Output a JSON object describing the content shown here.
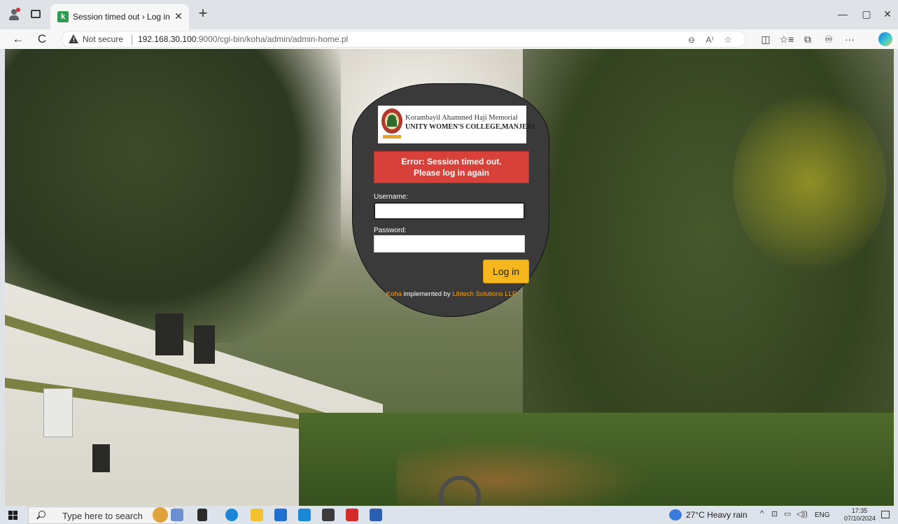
{
  "browser": {
    "tab": {
      "title": "Session timed out › Log in to Koh",
      "favicon_letter": "k",
      "close_glyph": "✕"
    },
    "new_tab_glyph": "+",
    "window_controls": {
      "minimize": "—",
      "restore": "▢",
      "close": "✕"
    },
    "nav": {
      "back_glyph": "←",
      "refresh_glyph": "C"
    },
    "address": {
      "security_label": "Not secure",
      "url_host": "192.168.30.100",
      "url_rest": ":9000/cgi-bin/koha/admin/admin-home.pl"
    },
    "omnibox_icons": {
      "zoom": "⊖",
      "read_aloud": "A⁾",
      "favorite": "☆"
    },
    "toolbar_icons": {
      "split": "◫",
      "favorites": "☆≡",
      "collections": "⧉",
      "extensions": "♾",
      "more": "···"
    }
  },
  "login": {
    "logo": {
      "line1": "Korambayil Ahammed Haji Memorial",
      "line2": "UNITY WOMEN'S COLLEGE,MANJERI"
    },
    "error": {
      "line1": "Error: Session timed out.",
      "line2": "Please log in again"
    },
    "username_label": "Username:",
    "username_value": "",
    "password_label": "Password:",
    "password_value": "",
    "submit_label": "Log in",
    "footer": {
      "koha": "Koha",
      "middle": " implemented by ",
      "vendor": "Libtech Solutions LLP"
    }
  },
  "taskbar": {
    "search_placeholder": "Type here to search",
    "weather": "27°C  Heavy rain",
    "language": "ENG",
    "time": "17:35",
    "date": "07/10/2024",
    "tray_glyphs": {
      "chevron": "^",
      "network": "⊡",
      "battery": "▭",
      "volume": "◁))"
    }
  },
  "colors": {
    "error_red": "#d8413a",
    "button_amber": "#f5b71b",
    "link_orange": "#f5a21b",
    "panel_dark": "#3a3a3a"
  }
}
